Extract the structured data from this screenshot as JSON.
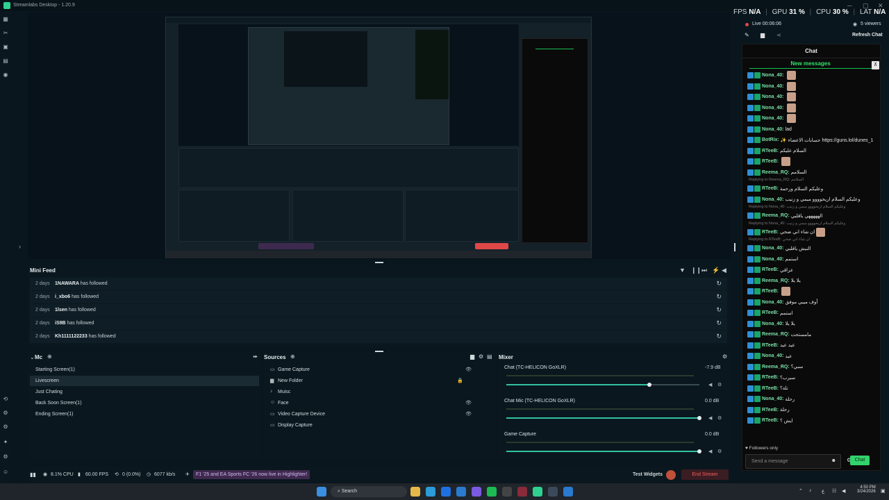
{
  "app": {
    "title": "Streamlabs Desktop - 1.20.9"
  },
  "stats": {
    "fps_label": "FPS",
    "fps_value": "N/A",
    "gpu_label": "GPU",
    "gpu_value": "31 %",
    "cpu_label": "CPU",
    "cpu_value": "30 %",
    "lat_label": "LAT",
    "lat_value": "N/A"
  },
  "live": {
    "status": "Live 00:06:06",
    "viewers": "5 viewers",
    "refresh_label": "Refresh Chat"
  },
  "chat": {
    "title": "Chat",
    "new_messages": "New messages",
    "messages": [
      {
        "user": "Nona_40:",
        "text": "",
        "emote": true
      },
      {
        "user": "Nona_40:",
        "text": "",
        "emote": true
      },
      {
        "user": "Nona_40:",
        "text": "",
        "emote": true
      },
      {
        "user": "Nona_40:",
        "text": "",
        "emote": true
      },
      {
        "user": "Nona_40:",
        "text": "",
        "emote": true
      },
      {
        "user": "Nona_40:",
        "text": "lad",
        "emote": false
      },
      {
        "user": "BotRix:",
        "text": "✨ حسابات الاعضاء https://guns.lol/dunes_1",
        "emote": false
      },
      {
        "user": "RTeeB:",
        "text": "السلام عليكم",
        "emote": false
      },
      {
        "user": "RTeeB:",
        "text": "",
        "emote": true
      },
      {
        "user": "Reema_RQ:",
        "text": "السلامم",
        "emote": false
      },
      {
        "reply": "Replying to Reema_RQ: السلامم",
        "user": "RTeeB:",
        "text": "وعليكم السلام ورحمة",
        "emote": false
      },
      {
        "user": "Nona_40:",
        "text": "وعليكم السلام اريحوووو ميمي و زنيب",
        "emote": false
      },
      {
        "reply": "Replying to Nona_40: وعليكم السلام اريحوووو ميمي و زنيب",
        "user": "Reema_RQ:",
        "text": "الهههههي ياقلبي",
        "emote": false
      },
      {
        "reply": "Replying to Nona_40: وعليكم السلام اريحوووو ميمي و زنيب",
        "user": "RTeeB:",
        "text": "ان شاء اني ضحي",
        "emote": true
      },
      {
        "reply": "Replying to RTeeB: ان شاء اني ضحي",
        "user": "Nona_40:",
        "text": "النيش ياقلبي",
        "emote": false
      },
      {
        "user": "Nona_40:",
        "text": "استمم",
        "emote": false
      },
      {
        "user": "RTeeB:",
        "text": "عراقي",
        "emote": false
      },
      {
        "user": "Reema_RQ:",
        "text": "يلا يلا",
        "emote": false
      },
      {
        "user": "RTeeB:",
        "text": "",
        "emote": true
      },
      {
        "user": "Nona_40:",
        "text": "أوف ميبي موفق",
        "emote": false
      },
      {
        "user": "RTeeB:",
        "text": "استمم",
        "emote": false
      },
      {
        "user": "Nona_40:",
        "text": "يلا يلا",
        "emote": false
      },
      {
        "user": "Reema_RQ:",
        "text": "مامستحت",
        "emote": false
      },
      {
        "user": "RTeeB:",
        "text": "عيد عيد",
        "emote": false
      },
      {
        "user": "Nona_40:",
        "text": "عيد",
        "emote": false
      },
      {
        "user": "Reema_RQ:",
        "text": "سبي؟",
        "emote": false
      },
      {
        "user": "RTeeB:",
        "text": "سيرب؟",
        "emote": false
      },
      {
        "user": "RTeeB:",
        "text": "تلة؟",
        "emote": false
      },
      {
        "user": "Nona_40:",
        "text": "رحلة",
        "emote": false
      },
      {
        "user": "RTeeB:",
        "text": "رحلة",
        "emote": false
      },
      {
        "user": "RTeeB:",
        "text": "ايش ؟",
        "emote": false
      }
    ],
    "followers_only": "Followers only",
    "send_placeholder": "Send a message",
    "send_button": "Chat"
  },
  "minifeed": {
    "title": "Mini Feed",
    "rows": [
      {
        "age": "2 days",
        "name": "1NAWARA",
        "action": "has followed"
      },
      {
        "age": "2 days",
        "name": "i_xbo6",
        "action": "has followed"
      },
      {
        "age": "2 days",
        "name": "1lsen",
        "action": "has followed"
      },
      {
        "age": "2 days",
        "name": "iS9B",
        "action": "has followed"
      },
      {
        "age": "2 days",
        "name": "Kh1111122233",
        "action": "has followed"
      }
    ]
  },
  "scenes": {
    "title": "Mc",
    "items": [
      "Starting Screen(1)",
      "Livescreen",
      "Just Chating",
      "Back Soon Screen(1)",
      "Ending Screen(1)"
    ],
    "selected_index": 1
  },
  "sources": {
    "title": "Sources",
    "items": [
      "Game Capture",
      "New Folder",
      "Muisc",
      "Face",
      "Video Capture Device",
      "Display Capture"
    ]
  },
  "mixer": {
    "title": "Mixer",
    "channels": [
      {
        "name": "Chat (TC-HELICON GoXLR)",
        "db": "-7.9 dB",
        "level": 0.74
      },
      {
        "name": "Chat Mic (TC-HELICON GoXLR)",
        "db": "0.0 dB",
        "level": 1.0
      },
      {
        "name": "Game Capture",
        "db": "0.0 dB",
        "level": 1.0
      }
    ]
  },
  "footer": {
    "cpu": "8.1% CPU",
    "fps": "60.00 FPS",
    "dropped": "0 (0.0%)",
    "bitrate": "6077 kb/s",
    "notice": "F1 '25 and EA Sports FC '26 now live in Highlighter!",
    "test_widgets": "Test Widgets",
    "end_stream": "End Stream"
  },
  "taskbar": {
    "search": "Search",
    "time": "4:50 PM",
    "date": "3/24/2026"
  },
  "colors": {
    "accent": "#31c3a2",
    "end_stream": "#e04848",
    "chat_green": "#32d36c",
    "notice_bg": "#3d2a4e"
  }
}
